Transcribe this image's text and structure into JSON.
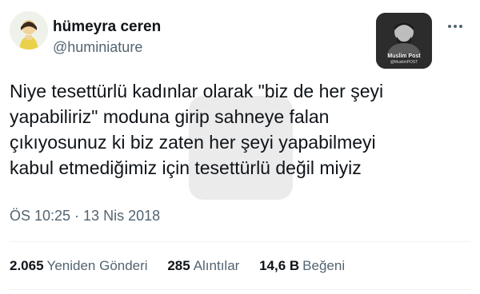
{
  "user": {
    "display_name": "hümeyra ceren",
    "handle": "@huminiature"
  },
  "watermark": {
    "title": "Muslim Post",
    "subtitle": "@MuslimPOST"
  },
  "tweet": {
    "text": "Niye tesettürlü kadınlar olarak \"biz de her şeyi\nyapabiliriz\" moduna girip sahneye falan\nçıkıyosunuz ki biz zaten her şeyi yapabilmeyi\nkabul etmediğimiz için tesettürlü değil miyiz",
    "timestamp": "ÖS 10:25 · 13 Nis 2018"
  },
  "stats": {
    "retweets": {
      "count": "2.065",
      "label": "Yeniden Gönderi"
    },
    "quotes": {
      "count": "285",
      "label": "Alıntılar"
    },
    "likes": {
      "count": "14,6 B",
      "label": "Beğeni"
    }
  },
  "icons": {
    "more": "more-horizontal-icon"
  },
  "colors": {
    "text_primary": "#0f1419",
    "text_secondary": "#536471",
    "divider": "#eff3f4"
  }
}
